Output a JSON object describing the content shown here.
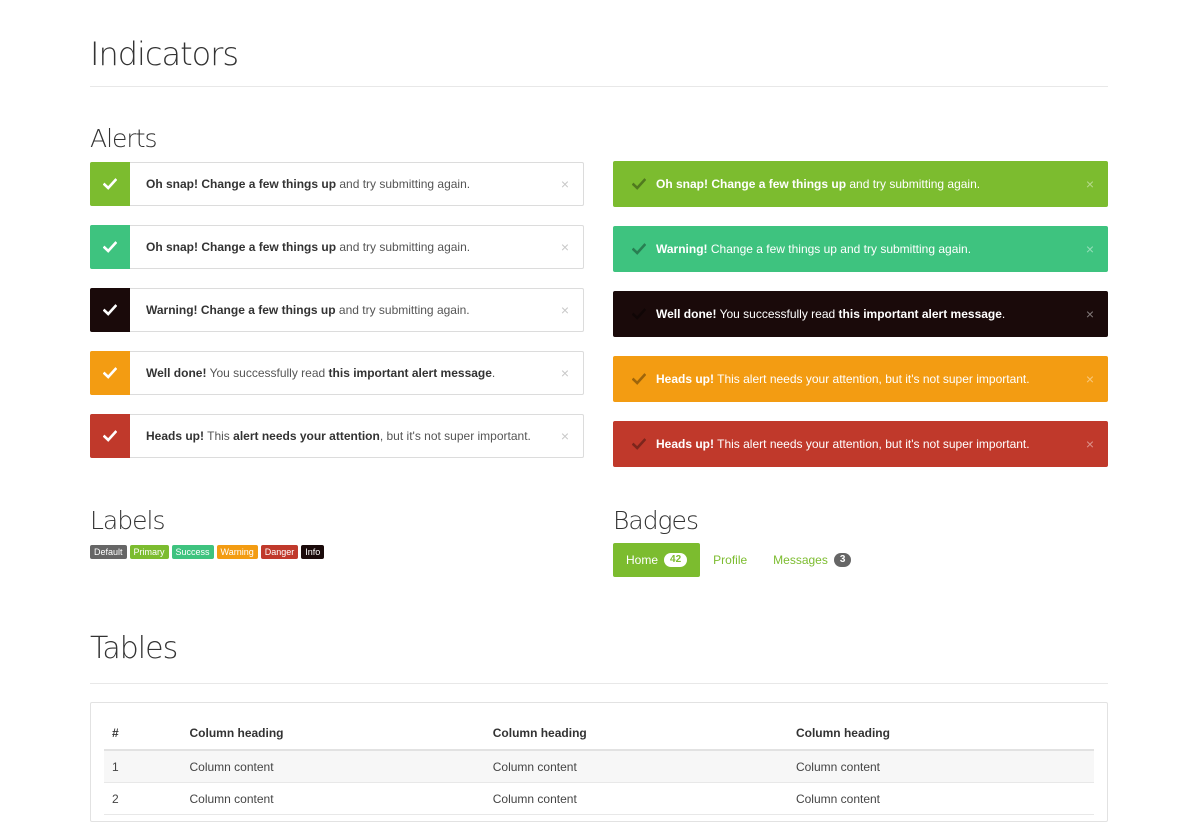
{
  "page": {
    "title": "Indicators"
  },
  "sections": {
    "alerts": "Alerts",
    "labels": "Labels",
    "badges": "Badges",
    "tables": "Tables"
  },
  "colors": {
    "green": "#7cbc2f",
    "teal": "#3ec37f",
    "dark": "#1a0a0a",
    "orange": "#f39c12",
    "red": "#c0392b",
    "gray": "#666666"
  },
  "close_glyph": "×",
  "outline_alerts": [
    {
      "color": "#7cbc2f",
      "bold1": "Oh snap!",
      "bold2": "Change a few things up",
      "rest": " and try submitting again."
    },
    {
      "color": "#3ec37f",
      "bold1": "Oh snap!",
      "bold2": "Change a few things up",
      "rest": " and try submitting again."
    },
    {
      "color": "#1a0a0a",
      "bold1": "Warning!",
      "bold2": "Change a few things up",
      "rest": " and try submitting again."
    },
    {
      "color": "#f39c12",
      "bold1": "Well done!",
      "text2": " You successfully read ",
      "bold3": "this important alert message",
      "rest": "."
    },
    {
      "color": "#c0392b",
      "bold1": "Heads up!",
      "text2": " This ",
      "bold3": "alert needs your attention",
      "rest": ", but it's not super important."
    }
  ],
  "filled_alerts": [
    {
      "color": "#7cbc2f",
      "bold1": "Oh snap!",
      "bold2": "Change a few things up",
      "rest": " and try submitting again."
    },
    {
      "color": "#3ec37f",
      "bold1": "Warning!",
      "rest": " Change a few things up and try submitting again."
    },
    {
      "color": "#1a0a0a",
      "bold1": "Well done!",
      "text2": " You successfully read ",
      "bold3": "this important alert message",
      "rest": "."
    },
    {
      "color": "#f39c12",
      "bold1": "Heads up!",
      "rest": " This alert needs your attention, but it's not super important."
    },
    {
      "color": "#c0392b",
      "bold1": "Heads up!",
      "rest": " This alert needs your attention, but it's not super important."
    }
  ],
  "labels": [
    {
      "text": "Default",
      "color": "#666666"
    },
    {
      "text": "Primary",
      "color": "#7cbc2f"
    },
    {
      "text": "Success",
      "color": "#3ec37f"
    },
    {
      "text": "Warning",
      "color": "#f39c12"
    },
    {
      "text": "Danger",
      "color": "#c0392b"
    },
    {
      "text": "Info",
      "color": "#1a0a0a"
    }
  ],
  "badges": [
    {
      "label": "Home",
      "count": "42",
      "active": true
    },
    {
      "label": "Profile",
      "count": "",
      "active": false
    },
    {
      "label": "Messages",
      "count": "3",
      "active": false
    }
  ],
  "table": {
    "headers": [
      "#",
      "Column heading",
      "Column heading",
      "Column heading"
    ],
    "rows": [
      [
        "1",
        "Column content",
        "Column content",
        "Column content"
      ],
      [
        "2",
        "Column content",
        "Column content",
        "Column content"
      ]
    ]
  }
}
